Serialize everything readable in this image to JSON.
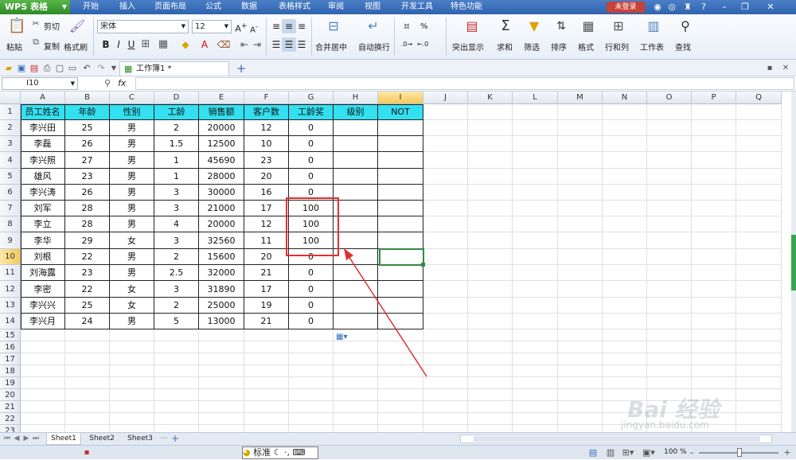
{
  "app": {
    "logo": "WPS 表格",
    "login": "未登录"
  },
  "menu": [
    "开始",
    "插入",
    "页面布局",
    "公式",
    "数据",
    "表格样式",
    "审阅",
    "视图",
    "开发工具",
    "特色功能"
  ],
  "ribbon": {
    "paste": "粘贴",
    "cut": "剪切",
    "copy": "复制",
    "format_painter": "格式刷",
    "font_name": "宋体",
    "font_size": "12",
    "merge_center": "合并居中",
    "wrap_text": "自动换行",
    "percent": "%",
    "highlight": "突出显示",
    "sum": "求和",
    "filter": "筛选",
    "sort": "排序",
    "format": "格式",
    "rows_cols": "行和列",
    "sheet": "工作表",
    "find": "查找"
  },
  "doc_tab": "工作簿1 *",
  "name_box": "I10",
  "fx": "fx",
  "columns": [
    "A",
    "B",
    "C",
    "D",
    "E",
    "F",
    "G",
    "H",
    "I",
    "J",
    "K",
    "L",
    "M",
    "N",
    "O",
    "P",
    "Q"
  ],
  "table": {
    "headers": [
      "员工姓名",
      "年龄",
      "性别",
      "工龄",
      "销售额",
      "客户数",
      "工龄奖",
      "级别",
      "NOT"
    ],
    "rows": [
      [
        "李兴田",
        "25",
        "男",
        "2",
        "20000",
        "12",
        "0",
        "",
        ""
      ],
      [
        "李磊",
        "26",
        "男",
        "1.5",
        "12500",
        "10",
        "0",
        "",
        ""
      ],
      [
        "李兴照",
        "27",
        "男",
        "1",
        "45690",
        "23",
        "0",
        "",
        ""
      ],
      [
        "雄风",
        "23",
        "男",
        "1",
        "28000",
        "20",
        "0",
        "",
        ""
      ],
      [
        "李兴涛",
        "26",
        "男",
        "3",
        "30000",
        "16",
        "0",
        "",
        ""
      ],
      [
        "刘军",
        "28",
        "男",
        "3",
        "21000",
        "17",
        "100",
        "",
        ""
      ],
      [
        "李立",
        "28",
        "男",
        "4",
        "20000",
        "12",
        "100",
        "",
        ""
      ],
      [
        "李华",
        "29",
        "女",
        "3",
        "32560",
        "11",
        "100",
        "",
        ""
      ],
      [
        "刘根",
        "22",
        "男",
        "2",
        "15600",
        "20",
        "0",
        "",
        ""
      ],
      [
        "刘海露",
        "23",
        "男",
        "2.5",
        "32000",
        "21",
        "0",
        "",
        ""
      ],
      [
        "李密",
        "22",
        "女",
        "3",
        "31890",
        "17",
        "0",
        "",
        ""
      ],
      [
        "李兴兴",
        "25",
        "女",
        "2",
        "25000",
        "19",
        "0",
        "",
        ""
      ],
      [
        "李兴月",
        "24",
        "男",
        "5",
        "13000",
        "21",
        "0",
        "",
        ""
      ]
    ]
  },
  "sheets": [
    "Sheet1",
    "Sheet2",
    "Sheet3"
  ],
  "status": {
    "ime": "标准",
    "zoom": "100 %"
  },
  "watermark": {
    "brand": "Bai 经验",
    "url": "jingyan.baidu.com"
  },
  "colors": {
    "header_fill": "#33e0f0",
    "annotation": "#e03030",
    "selection": "#2e8b3e"
  }
}
